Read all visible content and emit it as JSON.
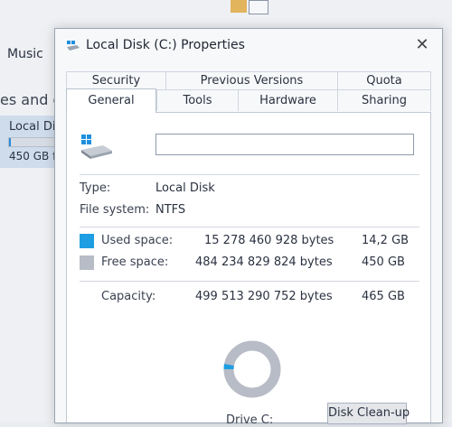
{
  "background": {
    "nav_item_music": "Music",
    "section_header_partial": "es and d",
    "drive_tile": {
      "name": "Local Di",
      "free_partial": "450 GB f",
      "used_fraction": 0.03
    }
  },
  "dialog": {
    "title": "Local Disk (C:) Properties",
    "close_glyph": "✕",
    "tabs_row1": [
      "Security",
      "Previous Versions",
      "Quota"
    ],
    "tabs_row2": [
      "General",
      "Tools",
      "Hardware",
      "Sharing"
    ],
    "active_tab": "General",
    "label_value": "",
    "type_label": "Type:",
    "type_value": "Local Disk",
    "fs_label": "File system:",
    "fs_value": "NTFS",
    "used": {
      "label": "Used space:",
      "bytes": "15 278 460 928 bytes",
      "size": "14,2 GB",
      "color": "#1e9ee2"
    },
    "free": {
      "label": "Free space:",
      "bytes": "484 234 829 824 bytes",
      "size": "450 GB",
      "color": "#b7bcc6"
    },
    "capacity": {
      "label": "Capacity:",
      "bytes": "499 513 290 752 bytes",
      "size": "465 GB"
    },
    "used_fraction": 0.0306,
    "drive_caption": "Drive C:",
    "cleanup_label": "Disk Clean-up"
  }
}
